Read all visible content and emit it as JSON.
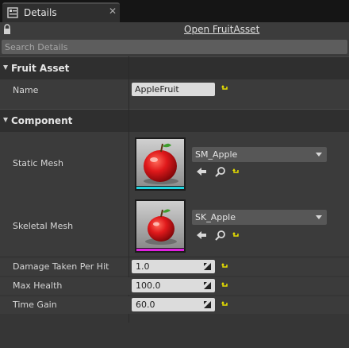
{
  "tab": {
    "title": "Details"
  },
  "toolbar": {
    "open_asset_label": "Open FruitAsset"
  },
  "search": {
    "placeholder": "Search Details"
  },
  "categories": {
    "fruit_asset": {
      "label": "Fruit Asset",
      "name_label": "Name",
      "name_value": "AppleFruit"
    },
    "component": {
      "label": "Component",
      "static_mesh_label": "Static Mesh",
      "static_mesh_value": "SM_Apple",
      "skeletal_mesh_label": "Skeletal Mesh",
      "skeletal_mesh_value": "SK_Apple",
      "damage_label": "Damage Taken Per Hit",
      "damage_value": "1.0",
      "max_health_label": "Max Health",
      "max_health_value": "100.0",
      "time_gain_label": "Time Gain",
      "time_gain_value": "60.0"
    }
  },
  "icons": {
    "tab": "details-icon",
    "lock": "lock-icon",
    "reset": "reset-to-default-icon",
    "use_selected": "arrow-left-icon",
    "browse": "magnifier-icon",
    "expand": "triangle-down-icon"
  },
  "colors": {
    "static_mesh_bar": "#1fd4e0",
    "skeletal_mesh_bar": "#e020e0",
    "reset_arrow": "#e8e000"
  }
}
